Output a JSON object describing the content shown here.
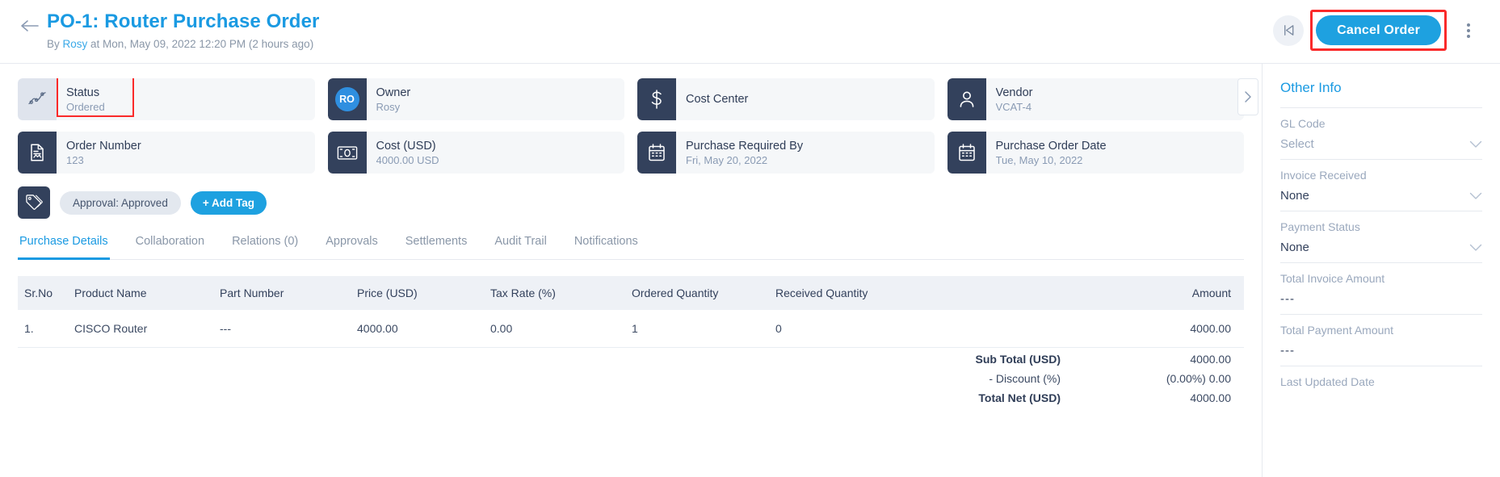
{
  "header": {
    "back_icon": "arrow-left-icon",
    "title": "PO-1: Router Purchase Order",
    "subtitle_prefix": "By ",
    "author": "Rosy",
    "subtitle_suffix": " at Mon, May 09, 2022 12:20 PM (2 hours ago)",
    "skip_back_icon": "skip-back-icon",
    "cancel_label": "Cancel Order",
    "kebab_icon": "more-vertical-icon",
    "highlight_color": "#fa2a2a",
    "accent_color": "#1ea1e0"
  },
  "cards": {
    "row1": [
      {
        "label": "Status",
        "value": "Ordered",
        "icon": "trend-chart-icon",
        "icon_style": "light",
        "highlighted": true
      },
      {
        "label": "Owner",
        "value": "Rosy",
        "icon": "avatar-icon",
        "avatar_initials": "RO"
      },
      {
        "label": "Cost Center",
        "value": "",
        "icon": "dollar-icon"
      },
      {
        "label": "Vendor",
        "value": "VCAT-4",
        "icon": "person-icon"
      }
    ],
    "row2": [
      {
        "label": "Order Number",
        "value": "123",
        "icon": "document-icon"
      },
      {
        "label": "Cost (USD)",
        "value": "4000.00 USD",
        "icon": "money-icon"
      },
      {
        "label": "Purchase Required By",
        "value": "Fri, May 20, 2022",
        "icon": "calendar-icon"
      },
      {
        "label": "Purchase Order Date",
        "value": "Tue, May 10, 2022",
        "icon": "calendar-icon"
      }
    ],
    "next_icon": "chevron-right-icon"
  },
  "tags": {
    "icon": "tag-icon",
    "chips": [
      "Approval: Approved"
    ],
    "add_label": "+ Add Tag"
  },
  "tabs": [
    {
      "label": "Purchase Details",
      "active": true
    },
    {
      "label": "Collaboration",
      "active": false
    },
    {
      "label": "Relations (0)",
      "active": false
    },
    {
      "label": "Approvals",
      "active": false
    },
    {
      "label": "Settlements",
      "active": false
    },
    {
      "label": "Audit Trail",
      "active": false
    },
    {
      "label": "Notifications",
      "active": false
    }
  ],
  "table": {
    "columns": [
      "Sr.No",
      "Product Name",
      "Part Number",
      "Price (USD)",
      "Tax Rate (%)",
      "Ordered Quantity",
      "Received Quantity",
      "Amount"
    ],
    "rows": [
      {
        "sr": "1.",
        "product": "CISCO Router",
        "part": "---",
        "price": "4000.00",
        "tax": "0.00",
        "ordered": "1",
        "received": "0",
        "amount": "4000.00"
      }
    ],
    "totals": [
      {
        "label": "Sub Total (USD)",
        "value": "4000.00",
        "bold": true
      },
      {
        "label": "- Discount (%)",
        "value": "(0.00%) 0.00",
        "bold": false
      },
      {
        "label": "Total Net (USD)",
        "value": "4000.00",
        "bold": true
      }
    ]
  },
  "sidebar": {
    "title": "Other Info",
    "fields": [
      {
        "label": "GL Code",
        "value": "Select",
        "type": "select",
        "placeholder": true
      },
      {
        "label": "Invoice Received",
        "value": "None",
        "type": "select",
        "placeholder": false
      },
      {
        "label": "Payment Status",
        "value": "None",
        "type": "select",
        "placeholder": false
      },
      {
        "label": "Total Invoice Amount",
        "value": "---",
        "type": "readonly",
        "placeholder": false
      },
      {
        "label": "Total Payment Amount",
        "value": "---",
        "type": "readonly",
        "placeholder": false
      },
      {
        "label": "Last Updated Date",
        "value": "",
        "type": "readonly",
        "placeholder": false
      }
    ],
    "chevron_icon": "chevron-down-icon"
  }
}
